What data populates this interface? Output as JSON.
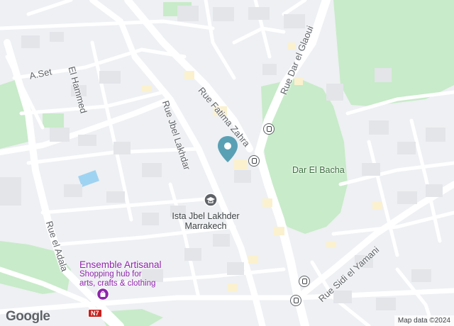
{
  "streets": {
    "rue_dar_el_glaoui": "Rue Dar el Glaoui",
    "rue_fatima_zahra": "Rue Fatima Zahra",
    "rue_jbel_lakhdar": "Rue Jbel Lakhdar",
    "rue_el_adala": "Rue el Adala",
    "el_hammed": "El Hammed",
    "a_set": "A.Set",
    "rue_sidi_el_yamani": "Rue Sidi el Yamani"
  },
  "places": {
    "dar_el_bacha": "Dar El Bacha",
    "ista_line1": "Ista Jbel Lakhder",
    "ista_line2": "Marrakech",
    "ensemble_title": "Ensemble Artisanal",
    "ensemble_desc1": "Shopping hub for",
    "ensemble_desc2": "arts, crafts & clothing"
  },
  "route_badge": "N7",
  "branding": {
    "logo": "Google"
  },
  "attribution": "Map data ©2024",
  "colors": {
    "park": "#c8ebc9",
    "road": "#ffffff",
    "water": "#9fd3f2",
    "accent": "#1a73e8",
    "pin": "#5aa0b5",
    "shopping": "#8e24aa"
  }
}
